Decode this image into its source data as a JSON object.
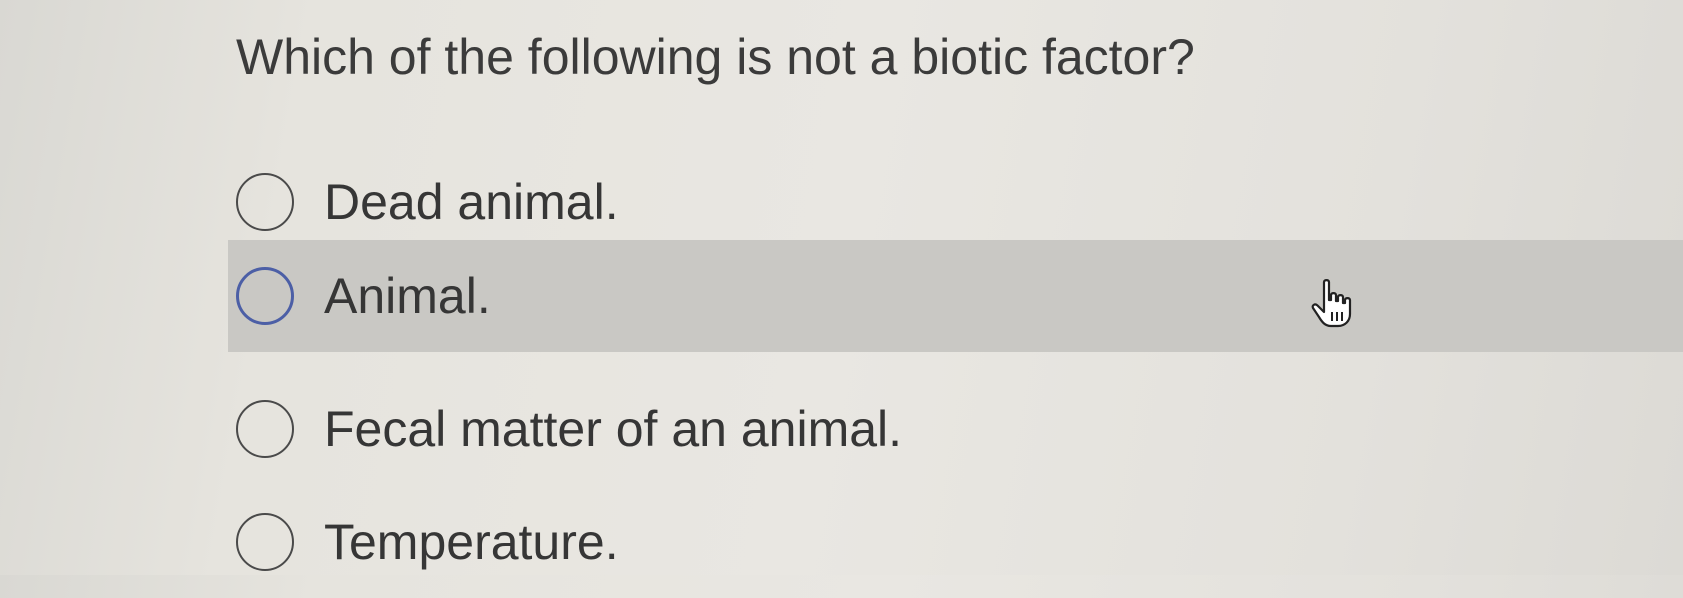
{
  "question": {
    "text": "Which of the following is not a biotic factor?"
  },
  "options": [
    {
      "label": "Dead animal.",
      "selected": false,
      "hovered": false
    },
    {
      "label": "Animal.",
      "selected": false,
      "hovered": true
    },
    {
      "label": "Fecal matter of an animal.",
      "selected": false,
      "hovered": false
    },
    {
      "label": "Temperature.",
      "selected": false,
      "hovered": false
    }
  ],
  "colors": {
    "hover_background": "#c9c8c4",
    "focus_ring": "#4c5fa6",
    "text": "#363636"
  },
  "cursor": {
    "icon": "hand-pointer-icon"
  }
}
